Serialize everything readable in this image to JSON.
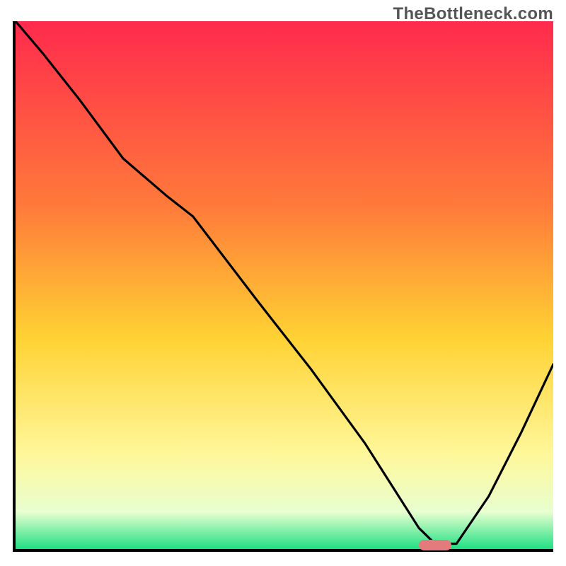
{
  "watermark": "TheBottleneck.com",
  "colors": {
    "axis": "#000000",
    "curve": "#000000",
    "marker": "#e37a7b",
    "top_gradient": "#ff2a4d",
    "mid_gradient_1": "#ff7a3a",
    "mid_gradient_2": "#ffd233",
    "low_gradient_1": "#fff79a",
    "low_gradient_2": "#e8ffd0",
    "bottom_gradient": "#1fe083"
  },
  "chart_data": {
    "type": "line",
    "title": "",
    "xlabel": "",
    "ylabel": "",
    "xlim": [
      0,
      100
    ],
    "ylim": [
      0,
      100
    ],
    "grid": false,
    "legend": false,
    "x": [
      0,
      5,
      12,
      20,
      28,
      33,
      45,
      55,
      65,
      70,
      75,
      78,
      82,
      88,
      94,
      100
    ],
    "values": [
      100,
      94,
      85,
      74,
      67,
      63,
      47,
      34,
      20,
      12,
      4,
      1,
      1,
      10,
      22,
      35
    ],
    "marker": {
      "x": 78,
      "y": 0,
      "width_pct": 6,
      "height_pct": 2
    },
    "gradient_stops": [
      {
        "offset_pct": 0,
        "color": "#ff2a4d"
      },
      {
        "offset_pct": 35,
        "color": "#ff7a3a"
      },
      {
        "offset_pct": 60,
        "color": "#ffd233"
      },
      {
        "offset_pct": 82,
        "color": "#fff79a"
      },
      {
        "offset_pct": 93,
        "color": "#e8ffd0"
      },
      {
        "offset_pct": 100,
        "color": "#1fe083"
      }
    ]
  }
}
